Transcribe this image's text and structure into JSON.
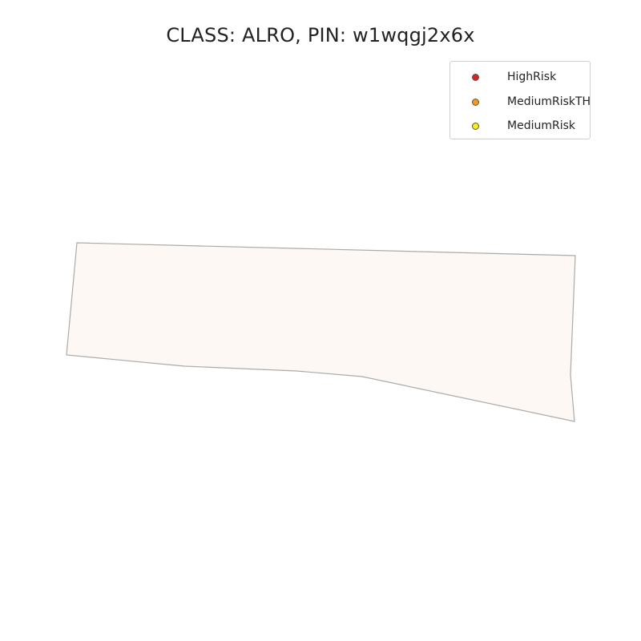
{
  "title": "CLASS: ALRO, PIN: w1wqgj2x6x",
  "parcel": {
    "fill_color": "#fdf8f4",
    "stroke_color": "#aaaaaa"
  },
  "legend": {
    "items": [
      {
        "label": "HighRisk",
        "color": "#e0201c"
      },
      {
        "label": "MediumRiskTH",
        "color": "#f29b1b"
      },
      {
        "label": "MediumRisk",
        "color": "#f7ee1a"
      }
    ]
  }
}
